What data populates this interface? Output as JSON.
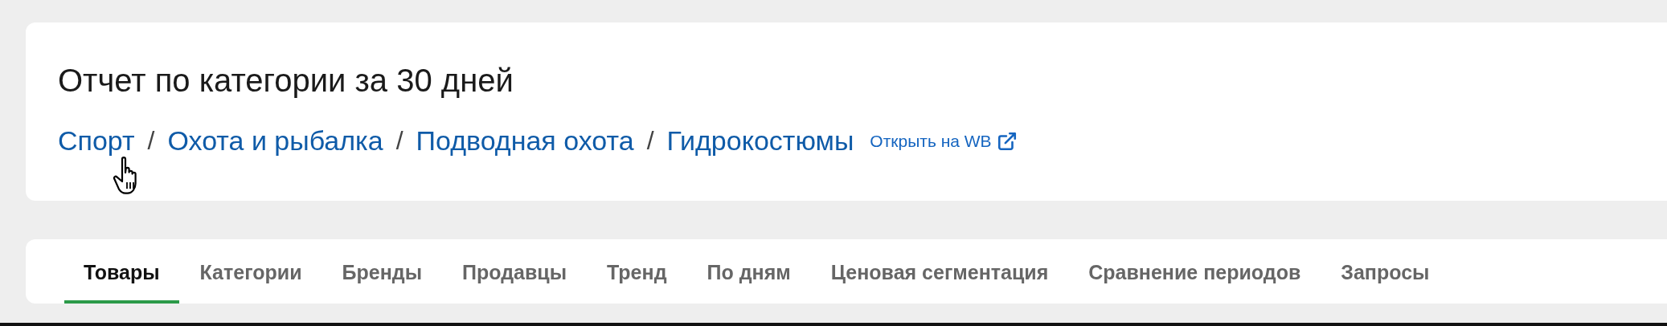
{
  "header": {
    "title": "Отчет по категории за 30 дней",
    "breadcrumbs": [
      "Спорт",
      "Охота и рыбалка",
      "Подводная охота",
      "Гидрокостюмы"
    ],
    "separator": "/",
    "external_link": "Открыть на WB"
  },
  "tabs": [
    {
      "label": "Товары",
      "selected": true
    },
    {
      "label": "Категории",
      "selected": false
    },
    {
      "label": "Бренды",
      "selected": false
    },
    {
      "label": "Продавцы",
      "selected": false
    },
    {
      "label": "Тренд",
      "selected": false
    },
    {
      "label": "По дням",
      "selected": false
    },
    {
      "label": "Ценовая сегментация",
      "selected": false
    },
    {
      "label": "Сравнение периодов",
      "selected": false
    },
    {
      "label": "Запросы",
      "selected": false
    }
  ]
}
